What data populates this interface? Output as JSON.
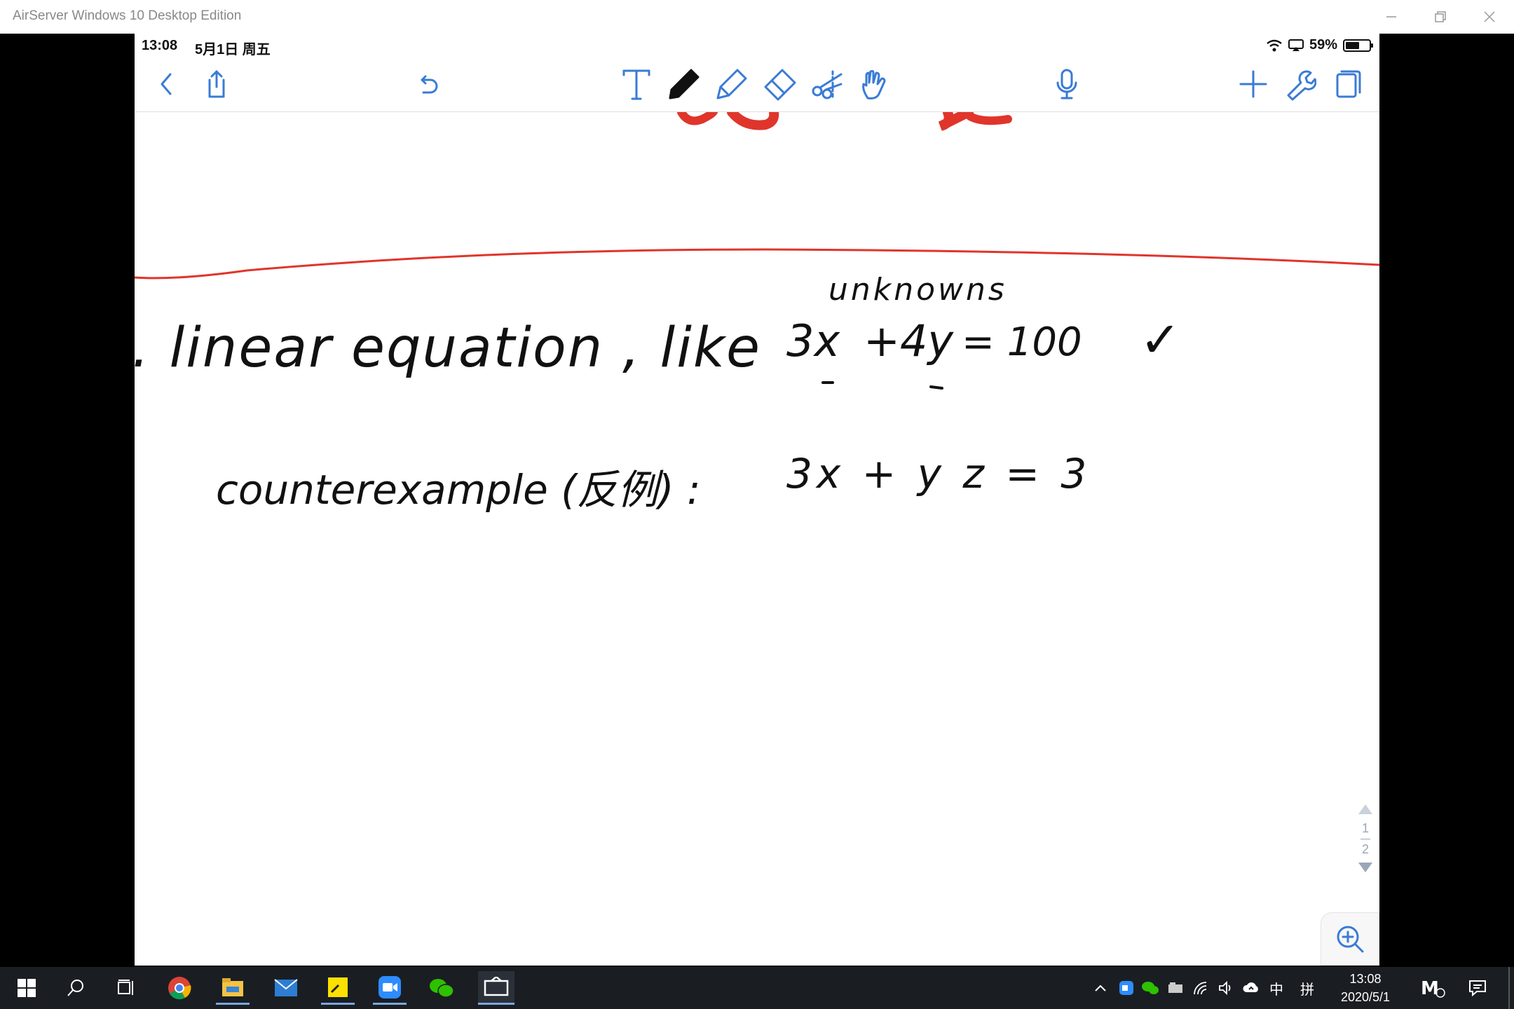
{
  "window": {
    "title": "AirServer Windows 10 Desktop Edition"
  },
  "ios_status": {
    "time": "13:08",
    "date": "5月1日 周五",
    "battery": "59%",
    "battery_level": 0.59
  },
  "toolbar": {
    "icons": [
      "back-icon",
      "share-icon",
      "undo-icon",
      "text-tool-icon",
      "pen-tool-icon",
      "highlighter-tool-icon",
      "eraser-tool-icon",
      "lasso-tool-icon",
      "hand-tool-icon",
      "microphone-icon",
      "add-page-icon",
      "settings-wrench-icon",
      "pages-icon"
    ]
  },
  "note": {
    "unknowns_label": "unknowns",
    "line1_text": ". linear equation , like",
    "line1_eq_a": "3x",
    "line1_eq_b": "+4y",
    "line1_eq_c": "= 100",
    "checkmark": "✓",
    "line2_text": "counterexample (反例) :",
    "line2_eq": "3x + y z = 3"
  },
  "pager": {
    "current": "1",
    "total": "2"
  },
  "taskbar": {
    "apps": [
      "windows-start-icon",
      "search-icon",
      "task-view-icon",
      "chrome-icon",
      "file-explorer-icon",
      "mail-icon",
      "sticky-notes-icon",
      "zoom-icon",
      "wechat-icon",
      "airserver-icon"
    ],
    "ime": "中",
    "ime2": "拼",
    "clock_time": "13:08",
    "clock_date": "2020/5/1"
  },
  "colors": {
    "accent": "#3a7bd5",
    "red_ink": "#e0352b",
    "taskbar": "#1a1e23"
  }
}
